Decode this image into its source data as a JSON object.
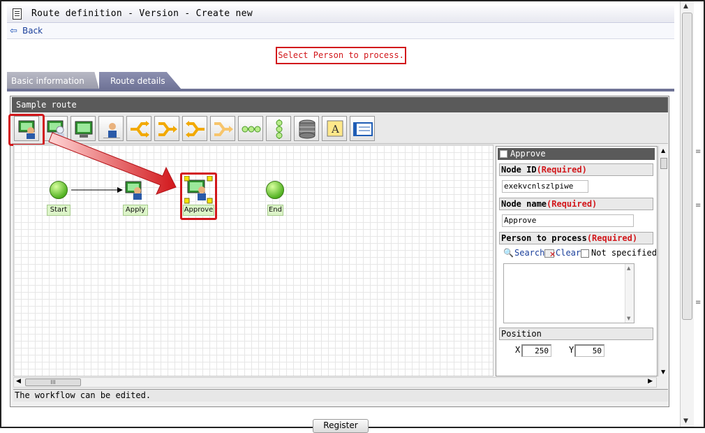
{
  "header": {
    "title": "Route definition - Version - Create new",
    "back_label": "Back"
  },
  "message": "Select Person to process.",
  "tabs": [
    {
      "label": "Basic information"
    },
    {
      "label": "Route details"
    }
  ],
  "panel": {
    "title": "Sample route",
    "status": "The workflow can be edited."
  },
  "toolbar": {
    "tools": [
      {
        "icon": "approve-node-icon"
      },
      {
        "icon": "apply-node-icon"
      },
      {
        "icon": "monitor-node-icon"
      },
      {
        "icon": "person-node-icon"
      },
      {
        "icon": "branch-icon"
      },
      {
        "icon": "merge-icon"
      },
      {
        "icon": "split-icon"
      },
      {
        "icon": "join-icon"
      },
      {
        "icon": "sequence-icon"
      },
      {
        "icon": "parallel-icon"
      },
      {
        "icon": "database-icon"
      },
      {
        "icon": "text-label-icon"
      },
      {
        "icon": "window-icon"
      }
    ]
  },
  "nodes": {
    "start": "Start",
    "apply": "Apply",
    "approve": "Approve",
    "end": "End"
  },
  "properties": {
    "heading": "Approve",
    "node_id_label": "Node ID",
    "required": "(Required)",
    "node_id_value": "exekvcnlszlpiwe",
    "node_name_label": "Node name",
    "node_name_value": "Approve",
    "person_label": "Person to process",
    "search_label": "Search",
    "clear_label": "Clear",
    "not_specified_label": "Not specified",
    "position_label": "Position",
    "x_label": "X",
    "x_value": "250",
    "y_label": "Y",
    "y_value": "50"
  },
  "scroll_thumb": "III",
  "register_label": "Register",
  "colors": {
    "accent_red": "#d2171b",
    "node_green": "#54b324",
    "tab_blue": "#6f7396"
  }
}
